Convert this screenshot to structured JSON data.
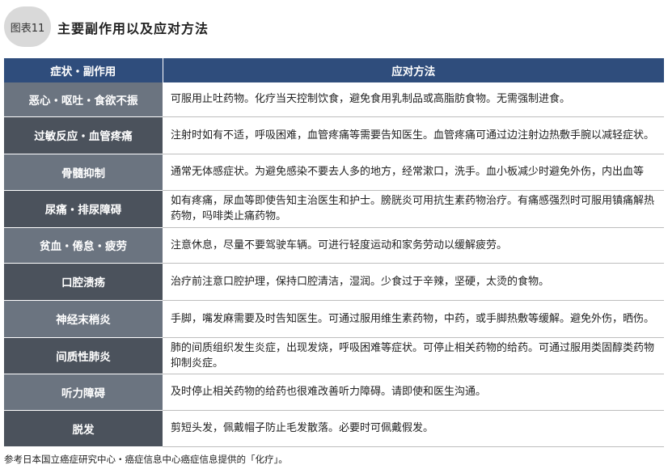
{
  "header": {
    "badge": "图表11",
    "title": "主要副作用以及应对方法"
  },
  "table": {
    "columns": [
      "症状・副作用",
      "应对方法"
    ],
    "rows": [
      {
        "symptom": "恶心・呕吐・食欲不振",
        "remedy": "可服用止吐药物。化疗当天控制饮食，避免食用乳制品或高脂肪食物。无需强制进食。"
      },
      {
        "symptom": "过敏反应・血管疼痛",
        "remedy": "注射时如有不适，呼吸困难，血管疼痛等需要告知医生。血管疼痛可通过边注射边热敷手腕以减轻症状。"
      },
      {
        "symptom": "骨髓抑制",
        "remedy": "通常无体感症状。为避免感染不要去人多的地方，经常漱口，洗手。血小板减少时避免外伤，内出血等"
      },
      {
        "symptom": "尿痛・排尿障碍",
        "remedy": "如有疼痛，尿血等即使告知主治医生和护士。膀胱炎可用抗生素药物治疗。有痛感强烈时可服用镇痛解热药物，吗啡类止痛药物。"
      },
      {
        "symptom": "贫血・倦怠・疲劳",
        "remedy": "注意休息，尽量不要驾驶车辆。可进行轻度运动和家务劳动以缓解疲劳。"
      },
      {
        "symptom": "口腔溃疡",
        "remedy": "治疗前注意口腔护理，保持口腔清洁，湿润。少食过于辛辣，坚硬，太烫的食物。"
      },
      {
        "symptom": "神经末梢炎",
        "remedy": "手脚，嘴发麻需要及时告知医生。可通过服用维生素药物，中药，或手脚热敷等缓解。避免外伤，晒伤。"
      },
      {
        "symptom": "间质性肺炎",
        "remedy": "肺的间质组织发生炎症，出现发烧，呼吸困难等症状。可停止相关药物的给药。可通过服用类固醇类药物抑制炎症。"
      },
      {
        "symptom": "听力障碍",
        "remedy": "及时停止相关药物的给药也很难改善听力障碍。请即使和医生沟通。"
      },
      {
        "symptom": "脱发",
        "remedy": "剪短头发，佩戴帽子防止毛发散落。必要时可佩戴假发。"
      }
    ]
  },
  "footer": {
    "source": "参考日本国立癌症研究中心・癌症信息中心癌症信息提供的「化疗」。"
  },
  "colors": {
    "header_bg": "#2f4d7c",
    "label_light": "#6b7480",
    "label_dark": "#4b525c"
  }
}
